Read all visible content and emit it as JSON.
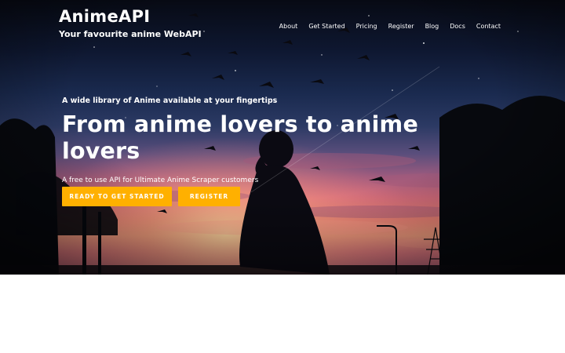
{
  "header": {
    "brand_title": "AnimeAPI",
    "brand_tagline": "Your favourite anime WebAPI"
  },
  "nav": {
    "items": [
      "About",
      "Get Started",
      "Pricing",
      "Register",
      "Blog",
      "Docs",
      "Contact"
    ]
  },
  "hero": {
    "kicker": "A wide library of Anime available at your fingertips",
    "headline": "From anime lovers to anime lovers",
    "subtext": "A free to use API for Ultimate Anime Scraper customers",
    "primary_button": "READY TO GET STARTED",
    "secondary_button": "REGISTER"
  },
  "colors": {
    "accent": "#ffb000",
    "sky_top": "#070a14",
    "sunset": "#ee8476"
  },
  "icons": {
    "background": "anime-night-sky-scene"
  }
}
